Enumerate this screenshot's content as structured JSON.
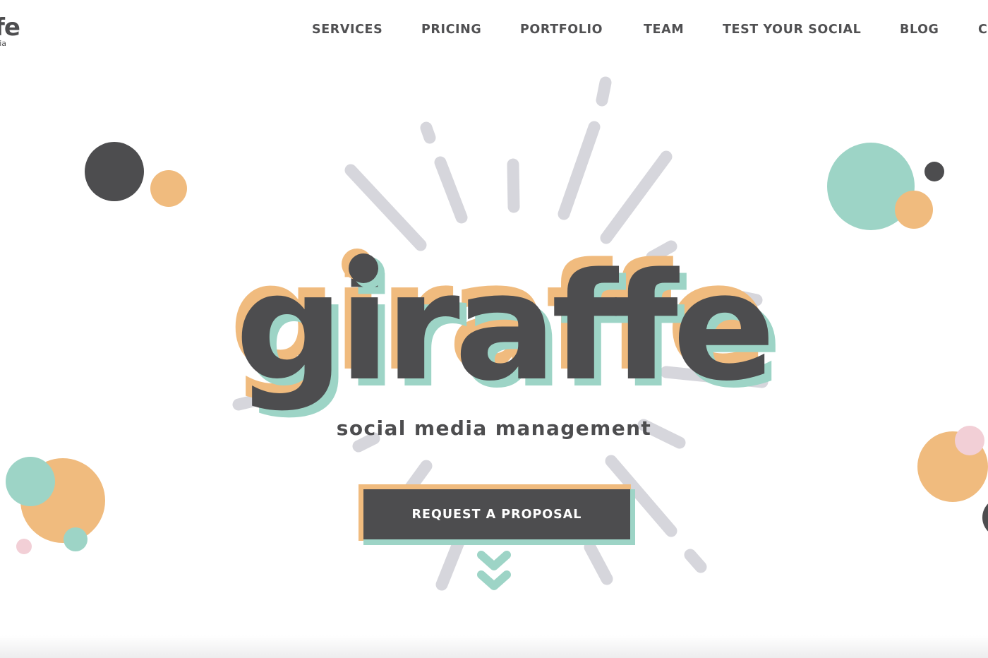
{
  "logo": {
    "wordmark": "giraffe",
    "subline": "social media"
  },
  "nav": {
    "items": [
      {
        "label": "SERVICES"
      },
      {
        "label": "PRICING"
      },
      {
        "label": "PORTFOLIO"
      },
      {
        "label": "TEAM"
      },
      {
        "label": "TEST YOUR SOCIAL"
      },
      {
        "label": "BLOG"
      },
      {
        "label": "C"
      }
    ]
  },
  "hero": {
    "title": "giraffe",
    "subtitle": "social media management",
    "cta_label": "REQUEST A PROPOSAL",
    "scroll_icon": "double-chevron-down-icon"
  },
  "colors": {
    "dark": "#4d4d4f",
    "orange": "#f0bb7e",
    "teal": "#9dd4c6",
    "pink": "#f2cfd6",
    "ray_gray": "#d6d6dc",
    "background": "#ffffff"
  }
}
